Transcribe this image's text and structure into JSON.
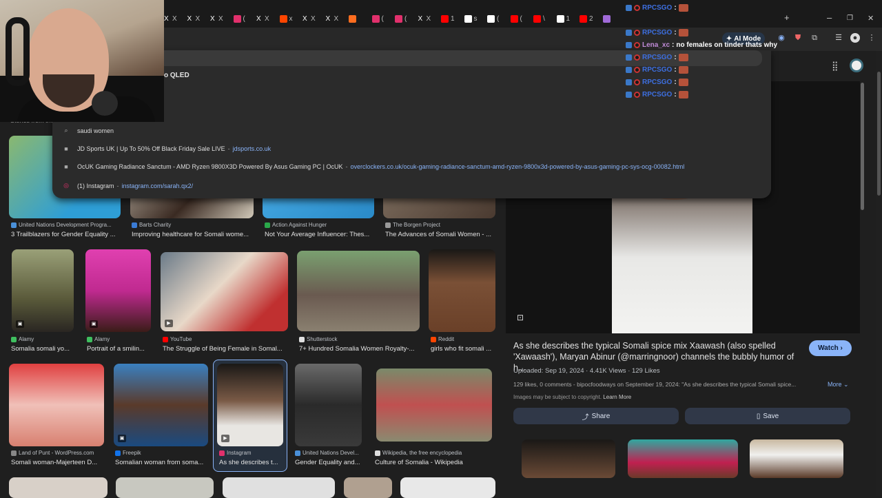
{
  "browser": {
    "tabs": [
      {
        "icon": "x-icon",
        "label": "X",
        "color": "#ffffff"
      },
      {
        "icon": "x-icon",
        "label": "X",
        "color": "#ffffff"
      },
      {
        "icon": "x-icon",
        "label": "X",
        "color": "#ffffff"
      },
      {
        "icon": "instagram-icon",
        "label": "(",
        "color": "#e1306c"
      },
      {
        "icon": "x-icon",
        "label": "X",
        "color": "#ffffff"
      },
      {
        "icon": "reddit-icon",
        "label": "x",
        "color": "#ff4500"
      },
      {
        "icon": "x-icon",
        "label": "X",
        "color": "#ffffff"
      },
      {
        "icon": "x-icon",
        "label": "X",
        "color": "#ffffff"
      },
      {
        "icon": "orange-icon",
        "label": "",
        "color": "#ff6d1f"
      },
      {
        "icon": "instagram-icon",
        "label": "(",
        "color": "#e1306c"
      },
      {
        "icon": "instagram-icon",
        "label": "(",
        "color": "#e1306c"
      },
      {
        "icon": "x-icon",
        "label": "X",
        "color": "#ffffff"
      },
      {
        "icon": "youtube-icon",
        "label": "1",
        "color": "#ff0000"
      },
      {
        "icon": "tiktok-icon",
        "label": "s",
        "color": "#ffffff"
      },
      {
        "icon": "openai-icon",
        "label": "(",
        "color": "#ffffff"
      },
      {
        "icon": "youtube-icon",
        "label": "(",
        "color": "#ff0000"
      },
      {
        "icon": "youtube-icon",
        "label": "\\",
        "color": "#ff0000"
      },
      {
        "icon": "tiktok-icon",
        "label": "1",
        "color": "#ffffff"
      },
      {
        "icon": "youtube-icon",
        "label": "2",
        "color": "#ff0000"
      },
      {
        "icon": "feather-icon",
        "label": "",
        "color": "#a06ad8"
      }
    ],
    "ai_mode_label": "AI Mode",
    "new_tab_symbol": "+",
    "window_min": "–",
    "window_max": "❐",
    "window_close": "✕"
  },
  "omnibox": {
    "partial_text": "o QLED",
    "suggestions": [
      {
        "icon": "search-icon",
        "text": "saudi women",
        "url": ""
      },
      {
        "icon": "jdsports-icon",
        "text": "JD Sports UK | Up To 50% Off Black Friday Sale LIVE",
        "url": "jdsports.co.uk"
      },
      {
        "icon": "ocuk-icon",
        "text": "OcUK Gaming Radiance Sanctum - AMD Ryzen 9800X3D Powered By Asus Gaming PC | OcUK",
        "url": "overclockers.co.uk/ocuk-gaming-radiance-sanctum-amd-ryzen-9800x3d-powered-by-asus-gaming-pc-sys-ocg-00082.html"
      },
      {
        "icon": "instagram-icon",
        "text": "(1) Instagram",
        "url": "instagram.com/sarah.qx2/"
      }
    ]
  },
  "chat": {
    "lines": [
      {
        "user": "RPCSGO",
        "sep": ":",
        "msg": "",
        "user_color": "#3d6fe0",
        "has_emote": true
      },
      {
        "user": "RPCSGO",
        "sep": ":",
        "msg": "",
        "user_color": "#3d6fe0",
        "has_emote": true
      },
      {
        "user": "Lena_xc",
        "sep": ":",
        "msg": "no females on tinder thats why",
        "user_color": "#c08bd8",
        "has_emote": false
      },
      {
        "user": "RPCSGO",
        "sep": ":",
        "msg": "",
        "user_color": "#3d6fe0",
        "has_emote": true
      },
      {
        "user": "RPCSGO",
        "sep": ":",
        "msg": "",
        "user_color": "#3d6fe0",
        "has_emote": true
      },
      {
        "user": "RPCSGO",
        "sep": ":",
        "msg": "",
        "user_color": "#3d6fe0",
        "has_emote": true
      },
      {
        "user": "RPCSGO",
        "sep": ":",
        "msg": "",
        "user_color": "#3d6fe0",
        "has_emote": true
      }
    ]
  },
  "results": {
    "stories_label": "Stories from the web",
    "row1": [
      {
        "source": "United Nations Development Progra...",
        "caption": "3 Trailblazers for Gender Equality ...",
        "fav_color": "#4a90d9"
      },
      {
        "source": "Barts Charity",
        "caption": "Improving healthcare for Somali wome...",
        "fav_color": "#3a7bd5"
      },
      {
        "source": "Action Against Hunger",
        "caption": "Not Your Average Influencer: Thes...",
        "fav_color": "#2aa84a"
      },
      {
        "source": "The Borgen Project",
        "caption": "The Advances of Somali Women - ...",
        "fav_color": "#999999"
      }
    ],
    "row2": [
      {
        "source": "Alamy",
        "caption": "Somalia somali yo...",
        "fav_color": "#3fbf5f"
      },
      {
        "source": "Alamy",
        "caption": "Portrait of a smilin...",
        "fav_color": "#3fbf5f"
      },
      {
        "source": "YouTube",
        "caption": "The Struggle of Being Female in Somal...",
        "fav_color": "#ff0000"
      },
      {
        "source": "Shutterstock",
        "caption": "7+ Hundred Somalia Women Royalty-...",
        "fav_color": "#e0e0e0"
      },
      {
        "source": "Reddit",
        "caption": "girls who fit somali ...",
        "fav_color": "#ff4500"
      }
    ],
    "row3": [
      {
        "source": "Land of Punt - WordPress.com",
        "caption": "Somali woman-Majerteen D...",
        "fav_color": "#888888"
      },
      {
        "source": "Freepik",
        "caption": "Somalian woman from soma...",
        "fav_color": "#1273eb"
      },
      {
        "source": "Instagram",
        "caption": "As she describes t...",
        "fav_color": "#e1306c"
      },
      {
        "source": "United Nations Devel...",
        "caption": "Gender Equality and...",
        "fav_color": "#4a90d9"
      },
      {
        "source": "Wikipedia, the free encyclopedia",
        "caption": "Culture of Somalia - Wikipedia",
        "fav_color": "#dddddd"
      }
    ]
  },
  "panel": {
    "title": "As she describes the typical Somali spice mix Xaawash (also spelled 'Xawaash'), Maryan Abinur (@marringnoor) channels the bubbly humor of h...",
    "watch_label": "Watch",
    "meta": "Uploaded: Sep 19, 2024 · 4.41K Views · 129 Likes",
    "description": "129 likes, 0 comments - bipocfoodways on September 19, 2024: \"As she describes the typical Somali spice...",
    "more_label": "More",
    "copyright_text": "Images may be subject to copyright.",
    "learn_more": "Learn More",
    "share_label": "Share",
    "save_label": "Save"
  }
}
